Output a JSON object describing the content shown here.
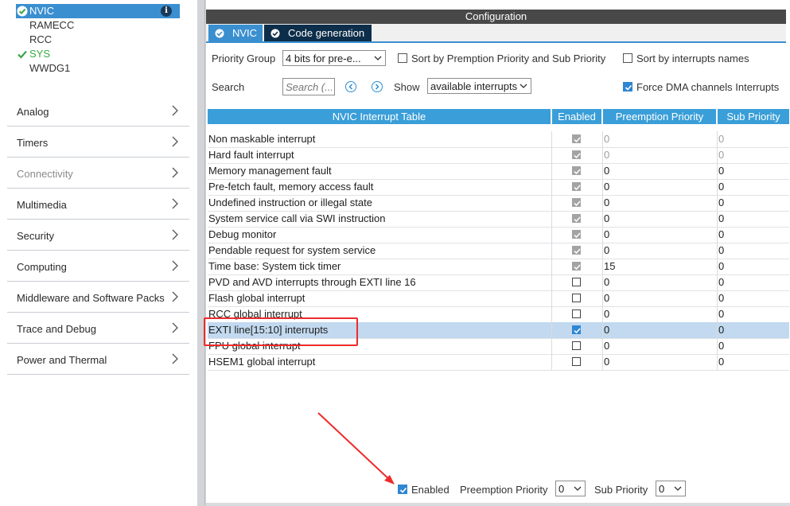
{
  "sidebar": {
    "tree": [
      {
        "label": "NVIC",
        "state": "selected"
      },
      {
        "label": "RAMECC",
        "state": "normal"
      },
      {
        "label": "RCC",
        "state": "normal"
      },
      {
        "label": "SYS",
        "state": "configured"
      },
      {
        "label": "WWDG1",
        "state": "normal"
      }
    ],
    "categories": [
      {
        "label": "Analog"
      },
      {
        "label": "Timers"
      },
      {
        "label": "Connectivity"
      },
      {
        "label": "Multimedia"
      },
      {
        "label": "Security"
      },
      {
        "label": "Computing"
      },
      {
        "label": "Middleware and Software Packs"
      },
      {
        "label": "Trace and Debug"
      },
      {
        "label": "Power and Thermal"
      }
    ]
  },
  "config": {
    "title": "Configuration",
    "tabs": [
      {
        "label": "NVIC"
      },
      {
        "label": "Code generation"
      }
    ],
    "priority_group_label": "Priority Group",
    "priority_group_value": "4 bits for pre-e...",
    "sort_preemption_label": "Sort by Premption Priority and Sub Priority",
    "sort_names_label": "Sort by interrupts names",
    "search_label": "Search",
    "search_placeholder": "Search (...",
    "show_label": "Show",
    "show_value": "available interrupts",
    "force_dma_label": "Force DMA channels Interrupts"
  },
  "table": {
    "headers": [
      "NVIC Interrupt Table",
      "Enabled",
      "Preemption Priority",
      "Sub Priority"
    ],
    "rows": [
      {
        "name": "Non maskable interrupt",
        "preemption": "0",
        "sub": "0"
      },
      {
        "name": "Hard fault interrupt",
        "preemption": "0",
        "sub": "0"
      },
      {
        "name": "Memory management fault",
        "preemption": "0",
        "sub": "0"
      },
      {
        "name": "Pre-fetch fault, memory access fault",
        "preemption": "0",
        "sub": "0"
      },
      {
        "name": "Undefined instruction or illegal state",
        "preemption": "0",
        "sub": "0"
      },
      {
        "name": "System service call via SWI instruction",
        "preemption": "0",
        "sub": "0"
      },
      {
        "name": "Debug monitor",
        "preemption": "0",
        "sub": "0"
      },
      {
        "name": "Pendable request for system service",
        "preemption": "0",
        "sub": "0"
      },
      {
        "name": "Time base: System tick timer",
        "preemption": "15",
        "sub": "0"
      },
      {
        "name": "PVD and AVD interrupts through EXTI line 16",
        "preemption": "0",
        "sub": "0"
      },
      {
        "name": "Flash global interrupt",
        "preemption": "0",
        "sub": "0"
      },
      {
        "name": "RCC global interrupt",
        "preemption": "0",
        "sub": "0"
      },
      {
        "name": "EXTI line[15:10] interrupts",
        "preemption": "0",
        "sub": "0"
      },
      {
        "name": "FPU global interrupt",
        "preemption": "0",
        "sub": "0"
      },
      {
        "name": "HSEM1 global interrupt",
        "preemption": "0",
        "sub": "0"
      }
    ]
  },
  "bottom": {
    "enabled_label": "Enabled",
    "preemption_label": "Preemption Priority",
    "preemption_value": "0",
    "sub_label": "Sub Priority",
    "sub_value": "0"
  },
  "colors": {
    "accent": "#3a9ed8",
    "tab_dark": "#0d2e4a",
    "selected_row": "#c2d9ef",
    "annotation": "#ee2b2b",
    "configured_green": "#3aa845"
  }
}
